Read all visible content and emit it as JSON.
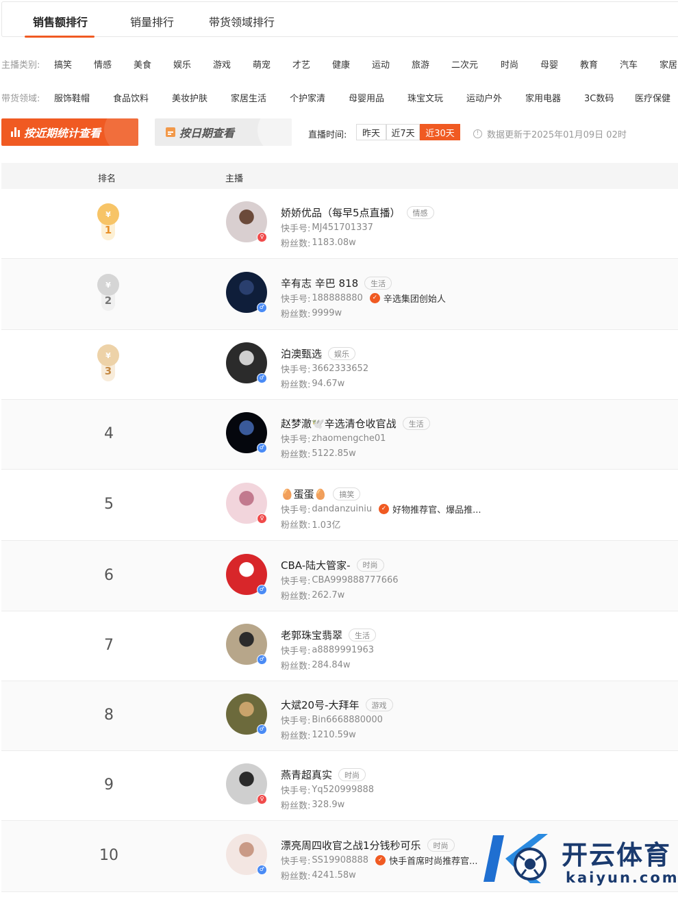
{
  "tabs": [
    {
      "label": "销售额排行",
      "active": true
    },
    {
      "label": "销量排行",
      "active": false
    },
    {
      "label": "带货领域排行",
      "active": false
    }
  ],
  "category_filter": {
    "label": "主播类别:",
    "items": [
      "搞笑",
      "情感",
      "美食",
      "娱乐",
      "游戏",
      "萌宠",
      "才艺",
      "健康",
      "运动",
      "旅游",
      "二次元",
      "时尚",
      "母婴",
      "教育",
      "汽车",
      "家居"
    ]
  },
  "domain_filter": {
    "label": "带货领域:",
    "items": [
      "服饰鞋帽",
      "食品饮料",
      "美妆护肤",
      "家居生活",
      "个护家清",
      "母婴用品",
      "珠宝文玩",
      "运动户外",
      "家用电器",
      "3C数码",
      "医疗保健"
    ]
  },
  "actions": {
    "recent_stats": "按近期统计查看",
    "by_date": "按日期查看"
  },
  "live_time": {
    "label": "直播时间:",
    "options": [
      "昨天",
      "近7天",
      "近30天"
    ],
    "selected": "近30天"
  },
  "update_info": "数据更新于2025年01月09日 02时",
  "table": {
    "col_rank": "排名",
    "col_streamer": "主播",
    "id_label": "快手号:",
    "fans_label": "粉丝数:"
  },
  "rows": [
    {
      "rank": "1",
      "name": "娇娇优品（每早5点直播）",
      "tag": "情感",
      "id": "MJ451701337",
      "fans": "1183.08w",
      "verify": "",
      "gender": "female",
      "medal": "gold",
      "avatar_color": "#d9cfd0",
      "avatar_accent": "#6b4a3a"
    },
    {
      "rank": "2",
      "name": "辛有志 辛巴 818",
      "tag": "生活",
      "id": "188888880",
      "fans": "9999w",
      "verify": "辛选集团创始人",
      "gender": "male",
      "medal": "silver",
      "avatar_color": "#0f1e3a",
      "avatar_accent": "#2a3f6e"
    },
    {
      "rank": "3",
      "name": "泊澳甄选",
      "tag": "娱乐",
      "id": "3662333652",
      "fans": "94.67w",
      "verify": "",
      "gender": "male",
      "medal": "bronze",
      "avatar_color": "#2b2b2b",
      "avatar_accent": "#cfcfcf"
    },
    {
      "rank": "4",
      "name": "赵梦澈🕊️辛选清仓收官战",
      "tag": "生活",
      "id": "zhaomengche01",
      "fans": "5122.85w",
      "verify": "",
      "gender": "male",
      "medal": "",
      "avatar_color": "#05070d",
      "avatar_accent": "#3a5a9a"
    },
    {
      "rank": "5",
      "name": "🥚蛋蛋🥚",
      "tag": "搞笑",
      "id": "dandanzuiniu",
      "fans": "1.03亿",
      "verify": "好物推荐官、爆品推...",
      "gender": "female",
      "medal": "",
      "avatar_color": "#f2d5dc",
      "avatar_accent": "#c27a8e"
    },
    {
      "rank": "6",
      "name": "CBA-陆大管家-",
      "tag": "时尚",
      "id": "CBA999888777666",
      "fans": "262.7w",
      "verify": "",
      "gender": "male",
      "medal": "",
      "avatar_color": "#d8262a",
      "avatar_accent": "#ffffff"
    },
    {
      "rank": "7",
      "name": "老郭珠宝翡翠",
      "tag": "生活",
      "id": "a8889991963",
      "fans": "284.84w",
      "verify": "",
      "gender": "male",
      "medal": "",
      "avatar_color": "#b7a68a",
      "avatar_accent": "#2b2b2b"
    },
    {
      "rank": "8",
      "name": "大斌20号-大拜年",
      "tag": "游戏",
      "id": "Bin6668880000",
      "fans": "1210.59w",
      "verify": "",
      "gender": "male",
      "medal": "",
      "avatar_color": "#6c6a3c",
      "avatar_accent": "#c9a36b"
    },
    {
      "rank": "9",
      "name": "燕青超真实",
      "tag": "时尚",
      "id": "Yq520999888",
      "fans": "328.9w",
      "verify": "",
      "gender": "female",
      "medal": "",
      "avatar_color": "#cfcfcf",
      "avatar_accent": "#2a2a2a"
    },
    {
      "rank": "10",
      "name": "漂亮周四收官之战1分钱秒可乐",
      "tag": "时尚",
      "id": "SS19908888",
      "fans": "4241.58w",
      "verify": "快手首席时尚推荐官...",
      "gender": "male",
      "medal": "",
      "avatar_color": "#f3e6e2",
      "avatar_accent": "#c99a86"
    }
  ],
  "watermark": {
    "cn": "开云体育",
    "en": "kaiyun.com"
  }
}
